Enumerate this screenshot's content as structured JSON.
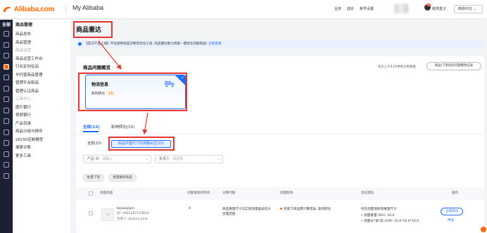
{
  "topbar": {
    "logo_text": "Alibaba.com",
    "app_title": "My Alibaba",
    "links": [
      "业务",
      "成长",
      "账号设置"
    ],
    "badge": "99",
    "user_name": "跨界盒子",
    "language": "简体中文 ⌄"
  },
  "sidebar": {
    "rail_title": "全部",
    "groups": [
      {
        "title": "商品管理",
        "items": [
          {
            "label": "商品发布",
            "muted": false
          },
          {
            "label": "商品管理",
            "muted": false
          },
          {
            "label": "商品运营",
            "muted": true
          },
          {
            "label": "商品运营工作台",
            "muted": false
          },
          {
            "label": "行业定向征品",
            "muted": false
          },
          {
            "label": "半托管商品管理",
            "muted": false
          },
          {
            "label": "管理平台新品",
            "muted": false
          },
          {
            "label": "管理认证商品",
            "muted": false
          },
          {
            "label": "工具中心",
            "muted": true
          },
          {
            "label": "图片银行",
            "muted": false
          },
          {
            "label": "视频银行",
            "muted": false
          },
          {
            "label": "产品目录",
            "muted": false
          },
          {
            "label": "商品分组与排序",
            "muted": false
          },
          {
            "label": "2D/3D定制模型",
            "muted": false
          },
          {
            "label": "搜索诊断",
            "muted": false
          },
          {
            "label": "更多工具",
            "muted": false
          }
        ]
      }
    ]
  },
  "main": {
    "page_title": "商品雷达",
    "notice": "【官方产品上线】平台提供商品诊断及优化工具, 商品雷达助力商家一键优化问题商品!",
    "notice_link": "立即查看",
    "overview_title": "商品问题概览",
    "overview_hint": "每天上午9:00更新诊断数据",
    "overview_button": "商品/下架风险问题整改记录",
    "metric": {
      "title": "物流信息",
      "label": "影响转化",
      "count": "15"
    },
    "tabs": [
      {
        "label": "全部(15)",
        "active": true
      },
      {
        "label": "影响转化(15)",
        "active": false
      }
    ],
    "sub_all": "全部(15)",
    "sub_chip": "商品件重尺寸内测量纠正(15)",
    "filters": {
      "product_id_label": "产品 ID",
      "product_id_placeholder": "请输入",
      "owner_label": "负责人",
      "owner_placeholder": "请选择"
    },
    "batch_buttons": [
      "批量下架",
      "批量删除商品"
    ],
    "table": {
      "headers": [
        "问题商品",
        "问题发现的时间",
        "诊断问题",
        "问题影响",
        "优化建议",
        "操作"
      ],
      "rows": [
        {
          "title": "kejiaoyipin",
          "id": "ID: 1601267133832",
          "owner": "负责人: Javona Juna",
          "time": "0",
          "problem": "商品重量尺寸与实际测量差异较大合理范围",
          "impact": "买家下单运费计算错误, 影响转化",
          "suggestion_title": "综合测量值修改重量尺寸",
          "suggestions": [
            "• 测量重量 (KG): 20.0",
            "• 测量长*宽*高 (CM): 10.0*10.0*10.0"
          ],
          "action_primary": "立即优化",
          "action_secondary": "申诉"
        }
      ]
    }
  },
  "colors": {
    "brand": "#ff6a00",
    "accent": "#1f6fff",
    "highlight": "#e3342f"
  }
}
